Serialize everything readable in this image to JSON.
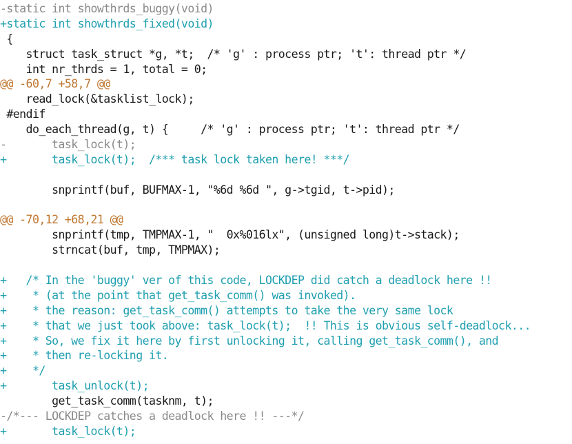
{
  "colors": {
    "background": "#ffffff",
    "removed": "#8a8a8a",
    "added": "#1f9fb0",
    "hunk_header": "#c07832",
    "context": "#1a1a1a"
  },
  "diff": {
    "lines": [
      {
        "type": "removed",
        "text": "-static int showthrds_buggy(void)"
      },
      {
        "type": "added",
        "text": "+static int showthrds_fixed(void)"
      },
      {
        "type": "context",
        "text": " {"
      },
      {
        "type": "context",
        "text": "    struct task_struct *g, *t;  /* 'g' : process ptr; 't': thread ptr */"
      },
      {
        "type": "context",
        "text": "    int nr_thrds = 1, total = 0;"
      },
      {
        "type": "hunk",
        "text": "@@ -60,7 +58,7 @@"
      },
      {
        "type": "context",
        "text": "    read_lock(&tasklist_lock);"
      },
      {
        "type": "context",
        "text": " #endif"
      },
      {
        "type": "context",
        "text": "    do_each_thread(g, t) {     /* 'g' : process ptr; 't': thread ptr */"
      },
      {
        "type": "removed",
        "text": "-       task_lock(t);"
      },
      {
        "type": "added",
        "text": "+       task_lock(t);  /*** task lock taken here! ***/"
      },
      {
        "type": "context",
        "text": ""
      },
      {
        "type": "context",
        "text": "        snprintf(buf, BUFMAX-1, \"%6d %6d \", g->tgid, t->pid);"
      },
      {
        "type": "context",
        "text": ""
      },
      {
        "type": "hunk",
        "text": "@@ -70,12 +68,21 @@"
      },
      {
        "type": "context",
        "text": "        snprintf(tmp, TMPMAX-1, \"  0x%016lx\", (unsigned long)t->stack);"
      },
      {
        "type": "context",
        "text": "        strncat(buf, tmp, TMPMAX);"
      },
      {
        "type": "context",
        "text": ""
      },
      {
        "type": "added",
        "text": "+   /* In the 'buggy' ver of this code, LOCKDEP did catch a deadlock here !!"
      },
      {
        "type": "added",
        "text": "+    * (at the point that get_task_comm() was invoked)."
      },
      {
        "type": "added",
        "text": "+    * the reason: get_task_comm() attempts to take the very same lock"
      },
      {
        "type": "added",
        "text": "+    * that we just took above: task_lock(t);  !! This is obvious self-deadlock..."
      },
      {
        "type": "added",
        "text": "+    * So, we fix it here by first unlocking it, calling get_task_comm(), and"
      },
      {
        "type": "added",
        "text": "+    * then re-locking it."
      },
      {
        "type": "added",
        "text": "+    */"
      },
      {
        "type": "added",
        "text": "+       task_unlock(t);"
      },
      {
        "type": "context",
        "text": "        get_task_comm(tasknm, t);"
      },
      {
        "type": "removed",
        "text": "-/*--- LOCKDEP catches a deadlock here !! ---*/"
      },
      {
        "type": "added",
        "text": "+       task_lock(t);"
      }
    ]
  }
}
